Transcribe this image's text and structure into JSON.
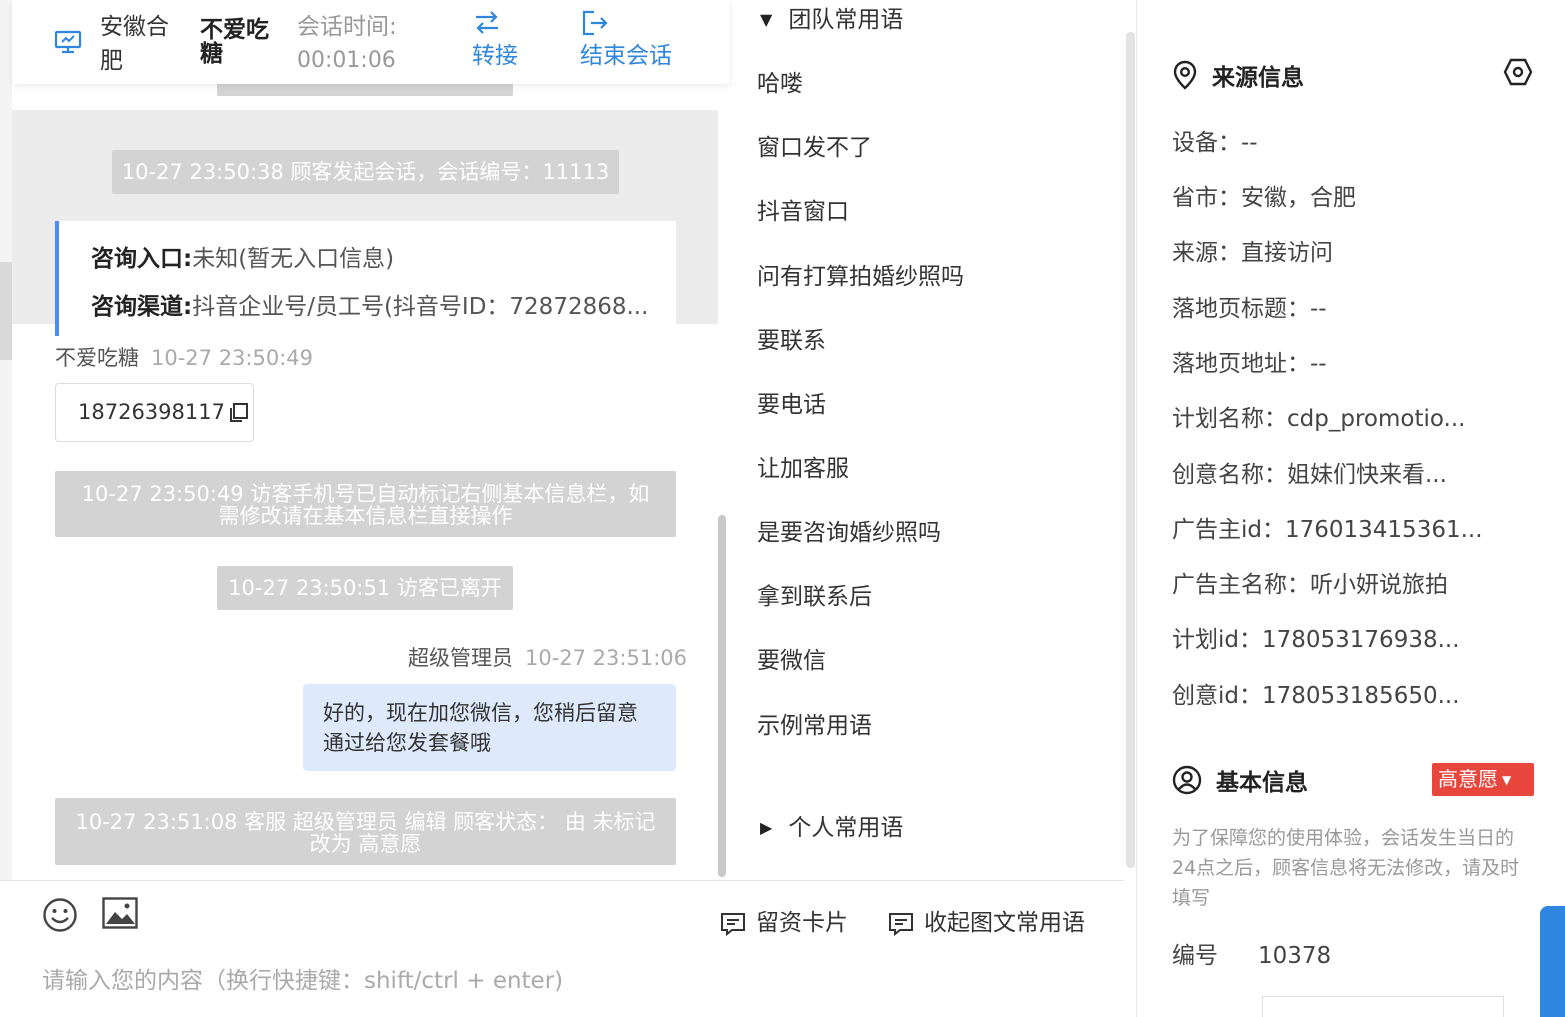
{
  "header": {
    "location": "安徽合肥",
    "customer_name": "不爱吃糖",
    "session_time_label": "会话时间:",
    "session_time": "00:01:06",
    "transfer_label": "转接",
    "end_session_label": "结束会话"
  },
  "chat": {
    "system_start": "10-27 23:50:38 顾客发起会话，会话编号：11113",
    "entry_label": "咨询入口:",
    "entry_value": "未知(暂无入口信息)",
    "channel_label": "咨询渠道:",
    "channel_value": "抖音企业号/员工号(抖音号ID：72872868...",
    "msg1_sender": "不爱吃糖",
    "msg1_time": "10-27 23:50:49",
    "msg1_phone": "18726398117",
    "system_auto_tag": "10-27 23:50:49 访客手机号已自动标记右侧基本信息栏，如需修改请在基本信息栏直接操作",
    "system_left": "10-27 23:50:51 访客已离开",
    "msg2_sender": "超级管理员",
    "msg2_time": "10-27 23:51:06",
    "msg2_text": "好的，现在加您微信，您稍后留意通过给您发套餐哦",
    "system_edit": "10-27 23:51:08 客服 超级管理员 编辑 顾客状态： 由 未标记 改为 高意愿"
  },
  "composer": {
    "placeholder": "请输入您的内容（换行快捷键：shift/ctrl + enter)",
    "card_label": "留资卡片",
    "collapse_label": "收起图文常用语"
  },
  "phrases": {
    "team_group_label": "团队常用语",
    "personal_group_label": "个人常用语",
    "items": [
      "哈喽",
      "窗口发不了",
      "抖音窗口",
      "问有打算拍婚纱照吗",
      "要联系",
      "要电话",
      "让加客服",
      "是要咨询婚纱照吗",
      "拿到联系后",
      "要微信",
      "示例常用语"
    ]
  },
  "info": {
    "source_title": "来源信息",
    "fields": [
      "设备：--",
      "省市：安徽，合肥",
      "来源：直接访问",
      "落地页标题：--",
      "落地页地址：--",
      "计划名称：cdp_promotio...",
      "创意名称：姐妹们快来看...",
      "广告主id：176013415361...",
      "广告主名称：听小妍说旅拍",
      "计划id：178053176938...",
      "创意id：178053185650..."
    ],
    "basic_title": "基本信息",
    "intent_tag": "高意愿",
    "notice": "为了保障您的使用体验，会话发生当日的24点之后，顾客信息将无法修改，请及时填写",
    "id_label": "编号",
    "id_value": "10378"
  },
  "colors": {
    "accent": "#2e86de",
    "system_pill": "#d3d3d3",
    "agent_bubble": "#deeafc",
    "entry_border": "#4e8cf5",
    "intent_tag": "#e8453c"
  }
}
